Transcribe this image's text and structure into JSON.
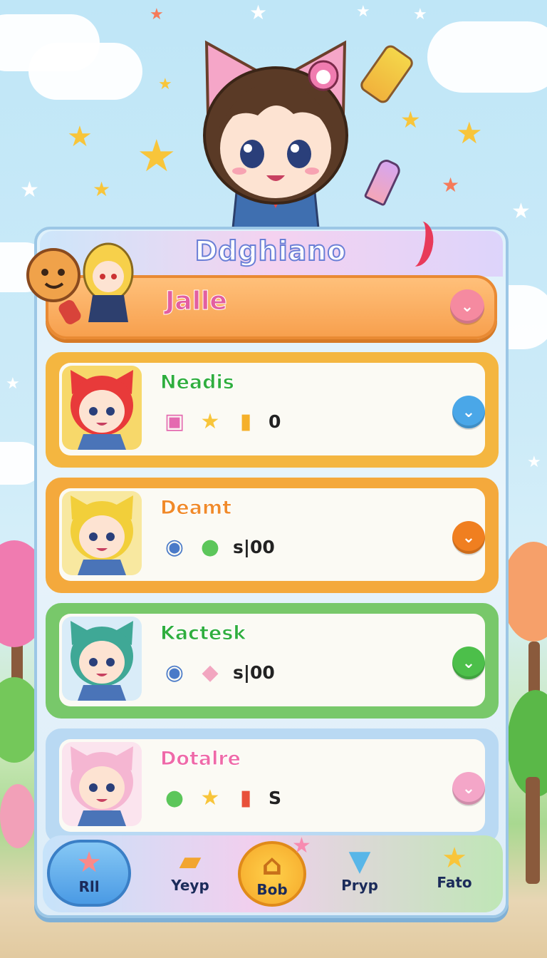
{
  "header": {
    "title": "Ddghiano"
  },
  "user": {
    "name": "Jalle",
    "chevron": "chevron-down-icon"
  },
  "cards": [
    {
      "title": "Neadis",
      "value": "0",
      "accent": "#f4b640",
      "title_color": "#2fae3e",
      "chevron_color": "#4aa7e8",
      "items": [
        "gift-icon",
        "star-icon",
        "juice-icon"
      ]
    },
    {
      "title": "Deamt",
      "value": "s|00",
      "accent": "#f4a93c",
      "title_color": "#f08a2a",
      "chevron_color": "#f07f20",
      "items": [
        "scroll-icon",
        "slime-icon"
      ]
    },
    {
      "title": "Kactesk",
      "value": "s|00",
      "accent": "#78c86a",
      "title_color": "#2fae3e",
      "chevron_color": "#4cbf4a",
      "items": [
        "scroll-icon",
        "cake-icon"
      ]
    },
    {
      "title": "Dotalre",
      "value": "S",
      "accent": "#b9d9f3",
      "title_color": "#ef6aa8",
      "chevron_color": "#f4a6c8",
      "items": [
        "slime-icon",
        "star-icon",
        "popsicle-icon"
      ]
    }
  ],
  "nav": [
    {
      "label": "Rll",
      "icon": "star-icon"
    },
    {
      "label": "Yeyp",
      "icon": "folder-icon"
    },
    {
      "label": "Bob",
      "icon": "home-icon"
    },
    {
      "label": "Pryp",
      "icon": "tag-icon"
    },
    {
      "label": "Fato",
      "icon": "star-icon"
    }
  ]
}
